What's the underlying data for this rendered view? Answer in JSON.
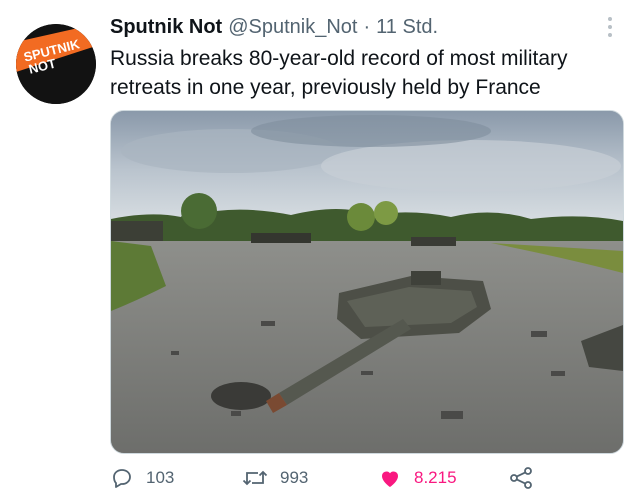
{
  "tweet": {
    "avatar_text": [
      "SPUTNIK",
      "NOT"
    ],
    "display_name": "Sputnik Not",
    "handle": "@Sputnik_Not",
    "separator": "·",
    "timestamp": "11 Std.",
    "text": "Russia breaks 80-year-old record of most military retreats in one year, previously held by France",
    "media": {
      "description_icon": "photo"
    },
    "actions": {
      "reply_count": "103",
      "retweet_count": "993",
      "like_count": "8.215"
    }
  },
  "colors": {
    "text": "#0f1419",
    "secondary": "#536471",
    "like": "#f91880",
    "avatar_orange": "#f26b22"
  }
}
